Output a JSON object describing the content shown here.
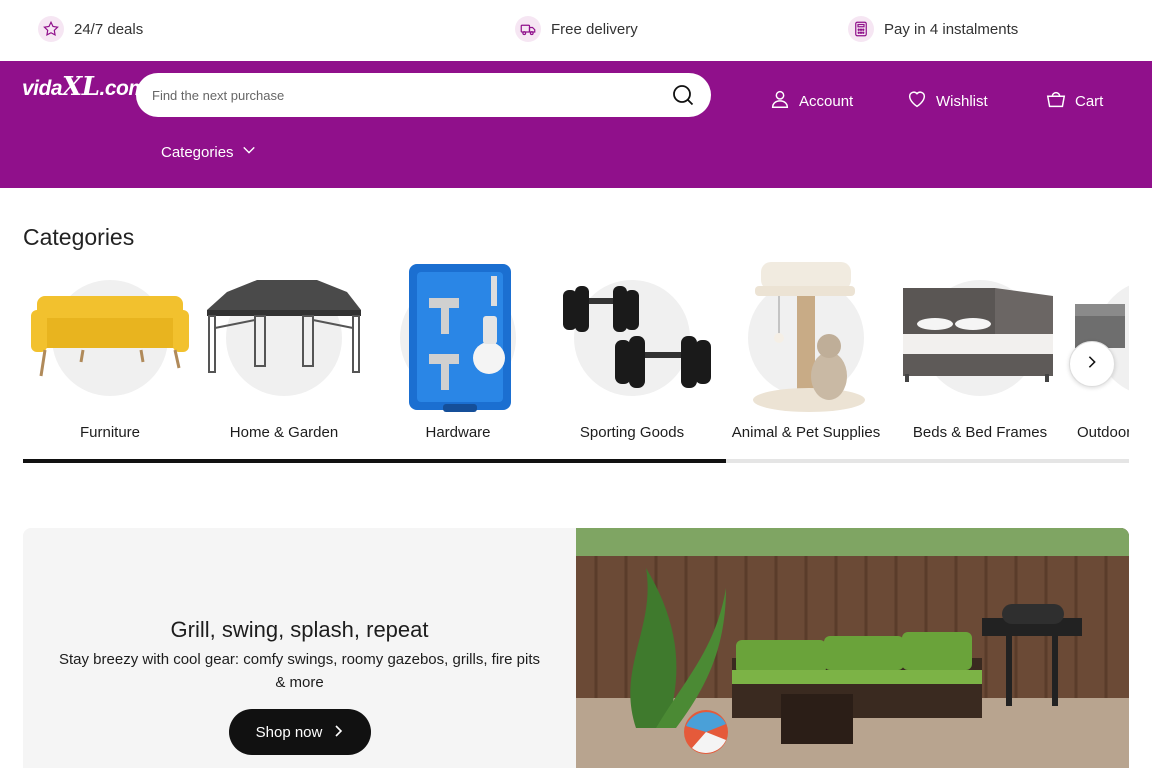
{
  "usp": {
    "deals": "24/7 deals",
    "delivery": "Free delivery",
    "instalments": "Pay in 4 instalments"
  },
  "header": {
    "logo_main": "vida",
    "logo_xl": "XL",
    "logo_suffix": ".com",
    "search_placeholder": "Find the next purchase",
    "account": "Account",
    "wishlist": "Wishlist",
    "cart": "Cart",
    "categories": "Categories",
    "brand_color": "#90108b"
  },
  "categories": {
    "title": "Categories",
    "items": [
      {
        "label": "Furniture",
        "icon": "sofa-image"
      },
      {
        "label": "Home & Garden",
        "icon": "gazebo-image"
      },
      {
        "label": "Hardware",
        "icon": "spray-gun-kit-image"
      },
      {
        "label": "Sporting Goods",
        "icon": "dumbbells-image"
      },
      {
        "label": "Animal & Pet Supplies",
        "icon": "cat-tree-image"
      },
      {
        "label": "Beds & Bed Frames",
        "icon": "bed-image"
      },
      {
        "label": "Outdoor",
        "icon": "outdoor-furniture-image"
      }
    ],
    "scroll_progress": 0.636
  },
  "promo": {
    "title": "Grill, swing, splash, repeat",
    "subtitle": "Stay breezy with cool gear: comfy swings, roomy gazebos, grills, fire pits & more",
    "button": "Shop now"
  }
}
